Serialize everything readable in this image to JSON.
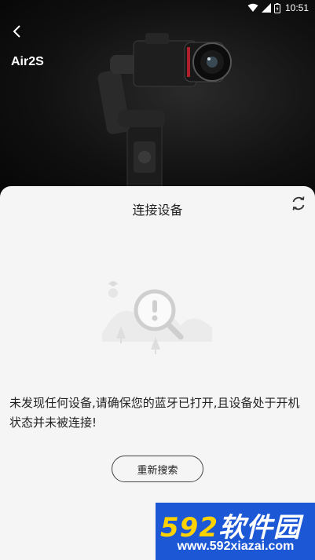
{
  "status_bar": {
    "time": "10:51",
    "icons": [
      "wifi-icon",
      "signal-icon",
      "battery-icon"
    ]
  },
  "header": {
    "device_name": "Air2S"
  },
  "sheet": {
    "title": "连接设备",
    "empty_message": "未发现任何设备,请确保您的蓝牙已打开,且设备处于开机状态并未被连接!",
    "research_button": "重新搜索"
  },
  "watermark": {
    "logo_number": "592",
    "logo_text": "软件园",
    "url": "www.592xiazai.com"
  },
  "colors": {
    "hero_bg": "#111111",
    "sheet_bg": "#f5f5f5",
    "watermark_bg": "#1c58d6",
    "watermark_accent": "#ffd200"
  }
}
